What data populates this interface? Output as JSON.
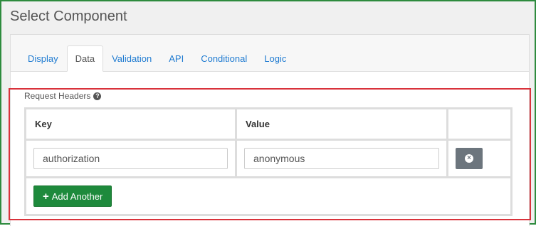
{
  "dialog": {
    "title": "Select Component"
  },
  "tabs": [
    {
      "label": "Display"
    },
    {
      "label": "Data"
    },
    {
      "label": "Validation"
    },
    {
      "label": "API"
    },
    {
      "label": "Conditional"
    },
    {
      "label": "Logic"
    }
  ],
  "active_tab": "Data",
  "request_headers": {
    "label": "Request Headers",
    "help_icon": "question-circle",
    "columns": {
      "key": "Key",
      "value": "Value"
    },
    "rows": [
      {
        "key": "authorization",
        "value": "anonymous"
      }
    ],
    "add_label": "Add Another"
  },
  "colors": {
    "frame_border": "#2e8b3e",
    "highlight_border": "#d9323b",
    "link": "#1f7bd1",
    "add_button": "#1e8a3c",
    "remove_button": "#6c757d"
  }
}
